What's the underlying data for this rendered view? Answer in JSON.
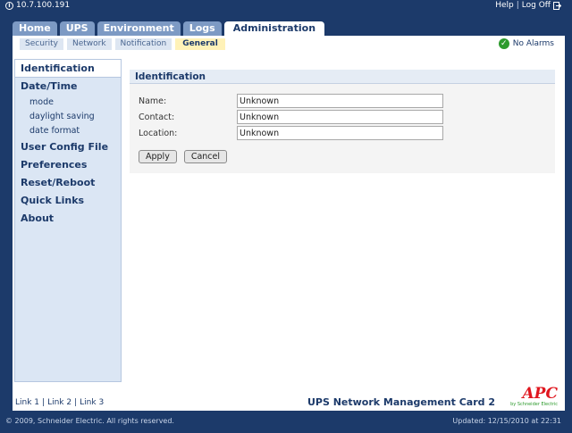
{
  "topbar": {
    "host": "10.7.100.191",
    "help_label": "Help",
    "logoff_label": "Log Off",
    "separator": "|"
  },
  "main_tabs": [
    {
      "label": "Home"
    },
    {
      "label": "UPS"
    },
    {
      "label": "Environment"
    },
    {
      "label": "Logs"
    },
    {
      "label": "Administration",
      "active": true
    }
  ],
  "sub_tabs": [
    {
      "label": "Security"
    },
    {
      "label": "Network"
    },
    {
      "label": "Notification"
    },
    {
      "label": "General",
      "active": true
    }
  ],
  "alarm": {
    "label": "No Alarms",
    "color": "#2d9a2d"
  },
  "sidebar": {
    "items": [
      {
        "label": "Identification",
        "active": true
      },
      {
        "label": "Date/Time"
      },
      {
        "label": "mode"
      },
      {
        "label": "daylight saving"
      },
      {
        "label": "date format"
      },
      {
        "label": "User Config File"
      },
      {
        "label": "Preferences"
      },
      {
        "label": "Reset/Reboot"
      },
      {
        "label": "Quick Links"
      },
      {
        "label": "About"
      }
    ]
  },
  "form": {
    "title": "Identification",
    "fields": [
      {
        "label": "Name:",
        "value": "Unknown"
      },
      {
        "label": "Contact:",
        "value": "Unknown"
      },
      {
        "label": "Location:",
        "value": "Unknown"
      }
    ],
    "apply_label": "Apply",
    "cancel_label": "Cancel"
  },
  "footer": {
    "links": [
      "Link 1",
      "Link 2",
      "Link 3"
    ],
    "link_separator": "|",
    "product": "UPS Network Management Card 2",
    "brand": "APC",
    "brand_sub": "by Schneider Electric",
    "brand_color": "#e0171f",
    "copyright": "© 2009, Schneider Electric. All rights reserved.",
    "updated": "Updated: 12/15/2010 at 22:31"
  },
  "colors": {
    "navy": "#1c3a6a",
    "tab": "#7d9ac4",
    "active_subtab": "#fff2b8"
  }
}
